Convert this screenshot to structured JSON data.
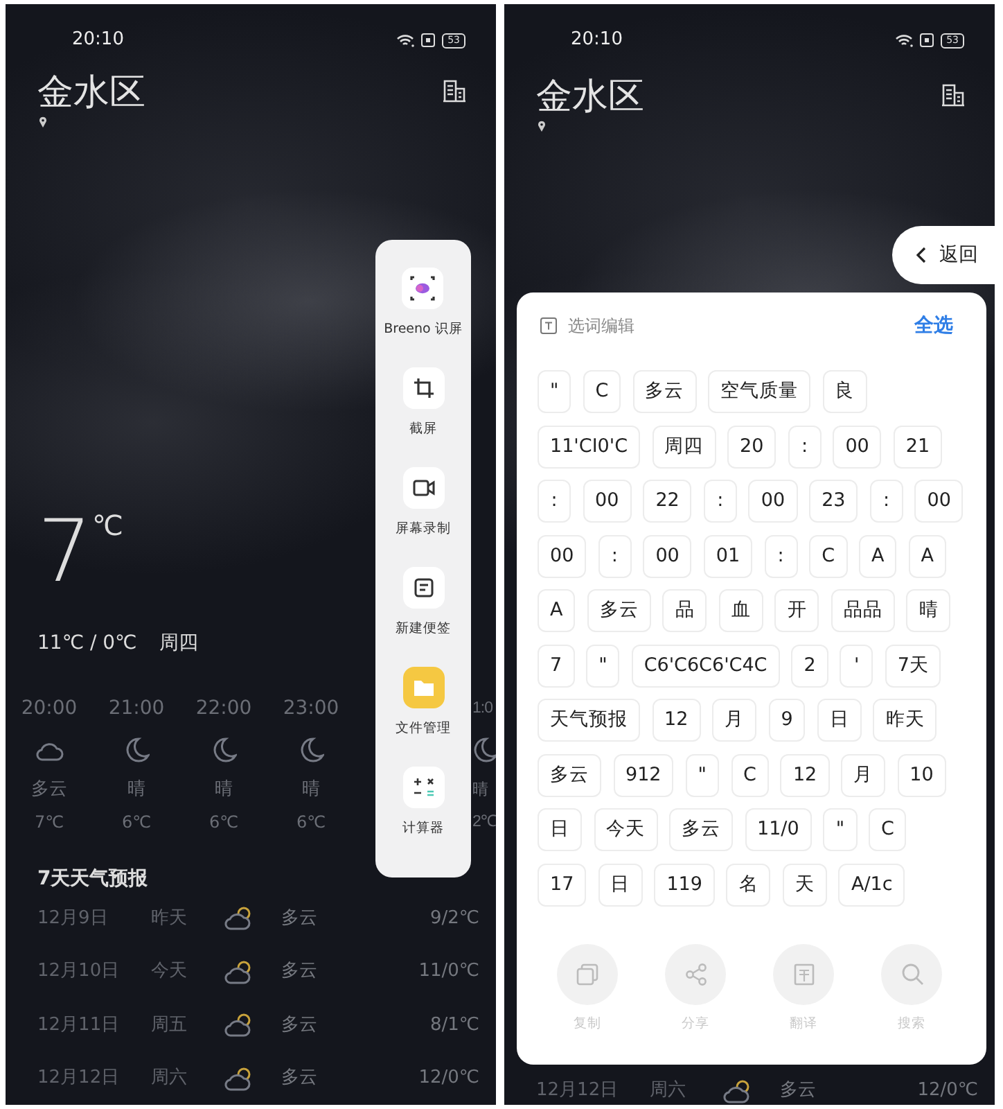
{
  "left_screen": {
    "status_bar": {
      "time": "20:10",
      "battery": "53"
    },
    "location": "金水区",
    "current": {
      "temperature": "7",
      "unit": "℃",
      "range": "11℃ / 0℃",
      "weekday": "周四"
    },
    "hourly": [
      {
        "time": "20:00",
        "kind": "cloud-moon",
        "condition": "多云",
        "temp": "7℃"
      },
      {
        "time": "21:00",
        "kind": "moon",
        "condition": "晴",
        "temp": "6℃"
      },
      {
        "time": "22:00",
        "kind": "moon",
        "condition": "晴",
        "temp": "6℃"
      },
      {
        "time": "23:00",
        "kind": "moon",
        "condition": "晴",
        "temp": "6℃"
      }
    ],
    "hourly_edge": {
      "time": "1:0",
      "kind": "moon",
      "condition": "晴",
      "temp": "2℃"
    },
    "forecast_title": "7天天气预报",
    "forecast": [
      {
        "date": "12月9日",
        "day": "昨天",
        "condition": "多云",
        "temp": "9/2℃"
      },
      {
        "date": "12月10日",
        "day": "今天",
        "condition": "多云",
        "temp": "11/0℃"
      },
      {
        "date": "12月11日",
        "day": "周五",
        "condition": "多云",
        "temp": "8/1℃"
      },
      {
        "date": "12月12日",
        "day": "周六",
        "condition": "多云",
        "temp": "12/0℃"
      }
    ],
    "side_panel": {
      "items": [
        {
          "kind": "breeno",
          "label": "Breeno 识屏"
        },
        {
          "kind": "crop",
          "label": "截屏"
        },
        {
          "kind": "record",
          "label": "屏幕录制"
        },
        {
          "kind": "note",
          "label": "新建便签"
        },
        {
          "kind": "folder",
          "label": "文件管理"
        },
        {
          "kind": "calculator",
          "label": "计算器"
        }
      ]
    }
  },
  "right_screen": {
    "status_bar": {
      "time": "20:10",
      "battery": "53"
    },
    "location": "金水区",
    "forecast": [
      {
        "date": "12月12日",
        "day": "周六",
        "condition": "多云",
        "temp": "12/0℃"
      }
    ],
    "back_button": {
      "label": "返回"
    },
    "word_panel": {
      "title": "选词编辑",
      "select_all": "全选",
      "chip_rows": [
        [
          "\"",
          "C",
          "多云",
          "空气质量",
          "良"
        ],
        [
          "11'CI0'C",
          "周四",
          "20",
          ":",
          "00",
          "21"
        ],
        [
          ":",
          "00",
          "22",
          ":",
          "00",
          "23",
          ":",
          "00"
        ],
        [
          "00",
          ":",
          "00",
          "01",
          ":",
          "C",
          "A",
          "A"
        ],
        [
          "A",
          "多云",
          "品",
          "血",
          "开",
          "品品",
          "晴"
        ],
        [
          "7",
          "\"",
          "C6'C6C6'C4C",
          "2",
          "'",
          "7天"
        ],
        [
          "天气预报",
          "12",
          "月",
          "9",
          "日",
          "昨天"
        ],
        [
          "多云",
          "912",
          "\"",
          "C",
          "12",
          "月",
          "10"
        ],
        [
          "日",
          "今天",
          "多云",
          "11/0",
          "\"",
          "C"
        ],
        [
          "17",
          "日",
          "119",
          "名",
          "天",
          "A/1c"
        ]
      ],
      "actions": [
        {
          "kind": "copy",
          "label": "复制",
          "disabled": true
        },
        {
          "kind": "share",
          "label": "分享",
          "disabled": true
        },
        {
          "kind": "translate",
          "label": "翻译",
          "disabled": true
        },
        {
          "kind": "search",
          "label": "搜索",
          "disabled": true
        }
      ]
    }
  }
}
